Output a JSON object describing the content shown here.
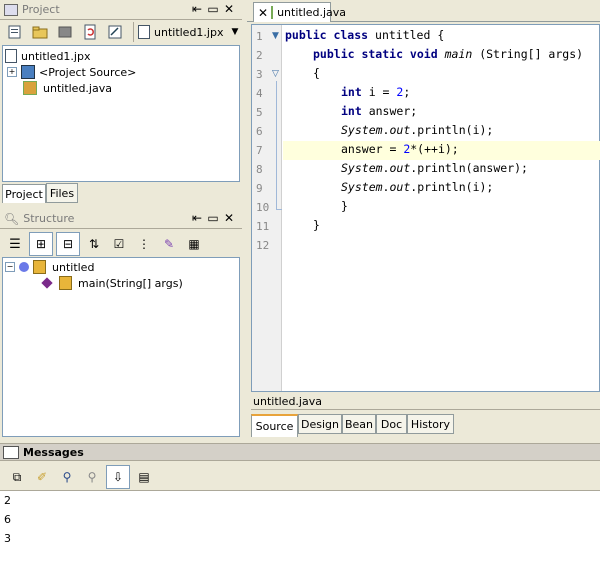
{
  "project_panel": {
    "title": "Project",
    "selector_label": "untitled1.jpx",
    "tree": [
      "untitled1.jpx",
      "<Project Source>",
      "untitled.java"
    ],
    "tabs": [
      "Project",
      "Files"
    ]
  },
  "structure_panel": {
    "title": "Structure",
    "tree": [
      "untitled",
      "main(String[] args)"
    ]
  },
  "editor": {
    "tab_label": "untitled.java",
    "status_file": "untitled.java",
    "line_numbers": [
      "1",
      "2",
      "3",
      "4",
      "5",
      "6",
      "7",
      "8",
      "9",
      "10",
      "11",
      "12"
    ],
    "lines": {
      "l1_kw": "public class",
      "l1_rest": " untitled {",
      "l2_kw": "public static void",
      "l2_name": "main",
      "l2_rest": " (String[] args)",
      "l3": "{",
      "l4_kw": "int",
      "l4_a": " i = ",
      "l4_num": "2",
      "l4_b": ";",
      "l5_kw": "int",
      "l5_rest": " answer;",
      "l6_sys": "System",
      "l6_dot": ".",
      "l6_out": "out",
      "l6_rest": ".println(i);",
      "l7_a": "answer = ",
      "l7_num": "2",
      "l7_rest": "*(++i);",
      "l8_sys": "System",
      "l8_dot": ".",
      "l8_out": "out",
      "l8_rest": ".println(answer);",
      "l9_sys": "System",
      "l9_dot": ".",
      "l9_out": "out",
      "l9_rest": ".println(i);",
      "l10": "}",
      "l11": "}"
    },
    "view_tabs": [
      "Source",
      "Design",
      "Bean",
      "Doc",
      "History"
    ]
  },
  "messages": {
    "title": "Messages",
    "output": [
      "2",
      "6",
      "3"
    ]
  }
}
